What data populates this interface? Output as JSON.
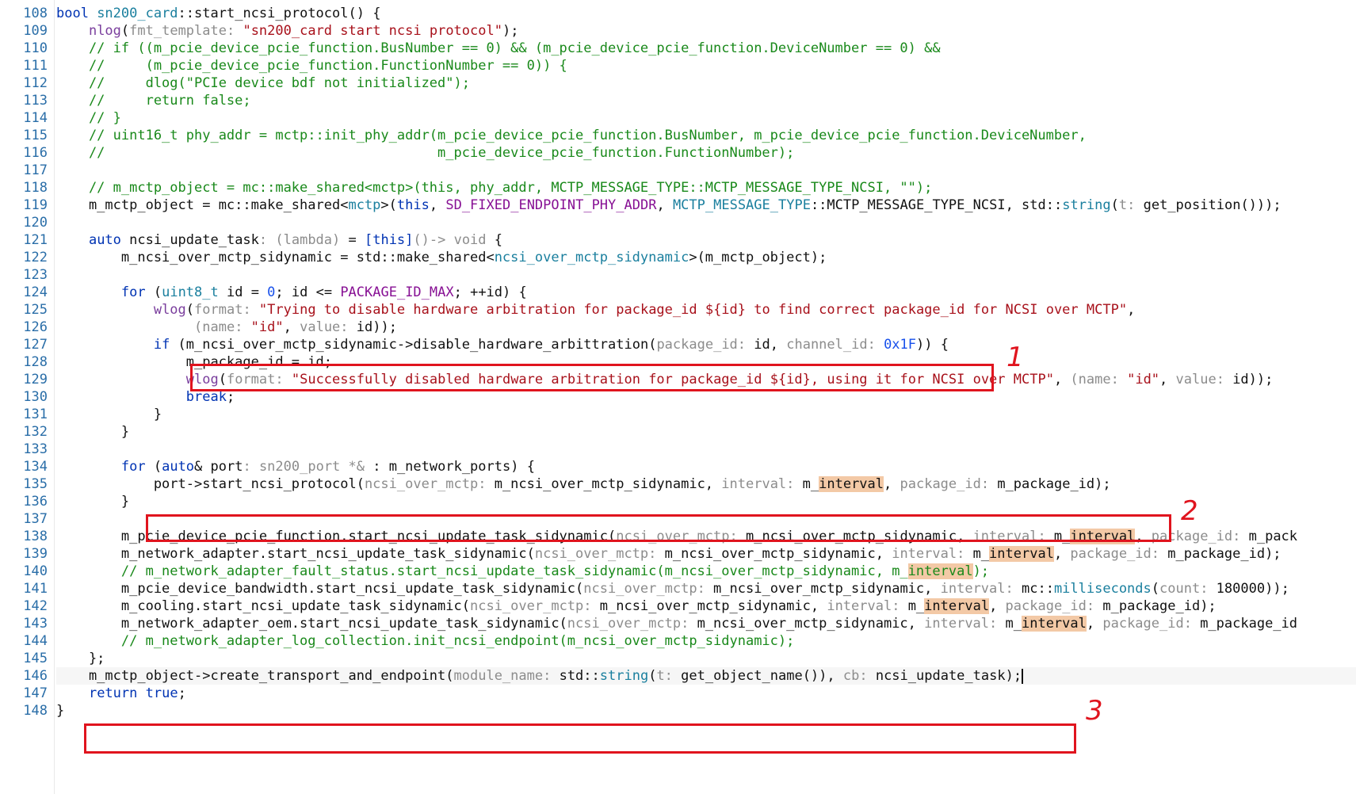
{
  "line_numbers": [
    "108",
    "109",
    "110",
    "111",
    "112",
    "113",
    "114",
    "115",
    "116",
    "117",
    "118",
    "119",
    "120",
    "121",
    "122",
    "123",
    "124",
    "125",
    "126",
    "127",
    "128",
    "129",
    "130",
    "131",
    "132",
    "133",
    "134",
    "135",
    "136",
    "137",
    "138",
    "139",
    "140",
    "141",
    "142",
    "143",
    "144",
    "145",
    "146",
    "147",
    "148"
  ],
  "code": {
    "l108": [
      "bool ",
      "sn200_card",
      "::",
      "start_ncsi_protocol",
      "() {"
    ],
    "l109": [
      "    ",
      "nlog",
      "(",
      "fmt_template: ",
      "\"sn200_card start ncsi protocol\"",
      ");"
    ],
    "l110": "    // if ((m_pcie_device_pcie_function.BusNumber == 0) && (m_pcie_device_pcie_function.DeviceNumber == 0) &&",
    "l111": "    //     (m_pcie_device_pcie_function.FunctionNumber == 0)) {",
    "l112": "    //     dlog(\"PCIe device bdf not initialized\");",
    "l113": "    //     return false;",
    "l114": "    // }",
    "l115": "    // uint16_t phy_addr = mctp::init_phy_addr(m_pcie_device_pcie_function.BusNumber, m_pcie_device_pcie_function.DeviceNumber,",
    "l116": "    //                                         m_pcie_device_pcie_function.FunctionNumber);",
    "l118": "    // m_mctp_object = mc::make_shared<mctp>(this, phy_addr, MCTP_MESSAGE_TYPE::MCTP_MESSAGE_TYPE_NCSI, \"\");",
    "l119": [
      "    m_mctp_object = mc::make_shared<",
      "mctp",
      ">(",
      "this",
      ", ",
      "SD_FIXED_ENDPOINT_PHY_ADDR",
      ", ",
      "MCTP_MESSAGE_TYPE",
      "::MCTP_MESSAGE_TYPE_NCSI, std::",
      "string",
      "(",
      "t: ",
      "get_position",
      "()));"
    ],
    "l121": [
      "    ",
      "auto",
      " ncsi_update_task",
      ": (lambda)",
      " = ",
      "[this]",
      "()-> void",
      " {"
    ],
    "l122": [
      "        m_ncsi_over_mctp_sidynamic = std::make_shared<",
      "ncsi_over_mctp_sidynamic",
      ">(m_mctp_object);"
    ],
    "l124": [
      "        ",
      "for",
      " (",
      "uint8_t",
      " id = ",
      "0",
      "; id <= ",
      "PACKAGE_ID_MAX",
      "; ++id) {"
    ],
    "l125": [
      "            ",
      "wlog",
      "(",
      "format: ",
      "\"Trying to disable hardware arbitration for package_id ${id} to find correct package_id for NCSI over MCTP\"",
      ","
    ],
    "l126": [
      "                 ",
      "(",
      "name: ",
      "\"id\"",
      ", ",
      "value: ",
      "id",
      "));"
    ],
    "l127": [
      "            ",
      "if",
      " (",
      "m_ncsi_over_mctp_sidynamic->disable_hardware_arbittration",
      "(",
      "package_id: ",
      "id",
      ", ",
      "channel_id: ",
      "0x1F",
      ")) {"
    ],
    "l128": "                m_package_id = id;",
    "l129": [
      "                ",
      "wlog",
      "(",
      "format: ",
      "\"Successfully disabled hardware arbitration for package_id ${id}, using it for NCSI over MCTP\"",
      ", ",
      "(",
      "name: ",
      "\"id\"",
      ", ",
      "value: ",
      "id",
      "));"
    ],
    "l130": [
      "                ",
      "break",
      ";"
    ],
    "l131": "            }",
    "l132": "        }",
    "l134": [
      "        ",
      "for",
      " (",
      "auto",
      "& port",
      ": sn200_port *&",
      " : m_network_ports) {"
    ],
    "l135": [
      "            port->start_ncsi_protocol(",
      "ncsi_over_mctp: ",
      "m_ncsi_over_mctp_sidynamic, ",
      "interval: ",
      "m_",
      "interval",
      ", ",
      "package_id: ",
      "m_package_id);"
    ],
    "l136": "        }",
    "l138": [
      "        m_pcie_device_pcie_function.start_ncsi_update_task_sidynamic(",
      "ncsi_over_mctp: ",
      "m_ncsi_over_mctp_sidynamic, ",
      "interval: ",
      "m_",
      "interval",
      ", ",
      "package_id: ",
      "m_pack"
    ],
    "l139": [
      "        m_network_adapter.start_ncsi_update_task_sidynamic(",
      "ncsi_over_mctp: ",
      "m_ncsi_over_mctp_sidynamic, ",
      "interval: ",
      "m_",
      "interval",
      ", ",
      "package_id: ",
      "m_package_id);"
    ],
    "l140": [
      "        // m_network_adapter_fault_status.start_ncsi_update_task_sidynamic(m_ncsi_over_mctp_sidynamic, m_",
      "interval",
      ");"
    ],
    "l141": [
      "        m_pcie_device_bandwidth.start_ncsi_update_task_sidynamic(",
      "ncsi_over_mctp: ",
      "m_ncsi_over_mctp_sidynamic, ",
      "interval: ",
      "mc::",
      "milliseconds",
      "(",
      "count: ",
      "180000",
      "));"
    ],
    "l142": [
      "        m_cooling.start_ncsi_update_task_sidynamic(",
      "ncsi_over_mctp: ",
      "m_ncsi_over_mctp_sidynamic, ",
      "interval: ",
      "m_",
      "interval",
      ", ",
      "package_id: ",
      "m_package_id);"
    ],
    "l143": [
      "        m_network_adapter_oem.start_ncsi_update_task_sidynamic(",
      "ncsi_over_mctp: ",
      "m_ncsi_over_mctp_sidynamic, ",
      "interval: ",
      "m_",
      "interval",
      ", ",
      "package_id: ",
      "m_package_id"
    ],
    "l144": "        // m_network_adapter_log_collection.init_ncsi_endpoint(m_ncsi_over_mctp_sidynamic);",
    "l145": "    };",
    "l146": [
      "    m_mctp_object->create_transport_and_endpoint(",
      "module_name: ",
      "std::",
      "string",
      "(",
      "t: ",
      "get_object_name",
      "()), ",
      "cb: ",
      "ncsi_update_task",
      ");"
    ],
    "l147": [
      "    ",
      "return",
      " ",
      "true",
      ";"
    ],
    "l148": "}"
  },
  "annotations": [
    "1",
    "2",
    "3"
  ],
  "colors": {
    "annotation": "#e0141e",
    "keyword": "#0033b3",
    "string": "#a8111b",
    "comment": "#19891a",
    "hint": "#8c8c8c",
    "highlight": "#f3c9a6"
  }
}
